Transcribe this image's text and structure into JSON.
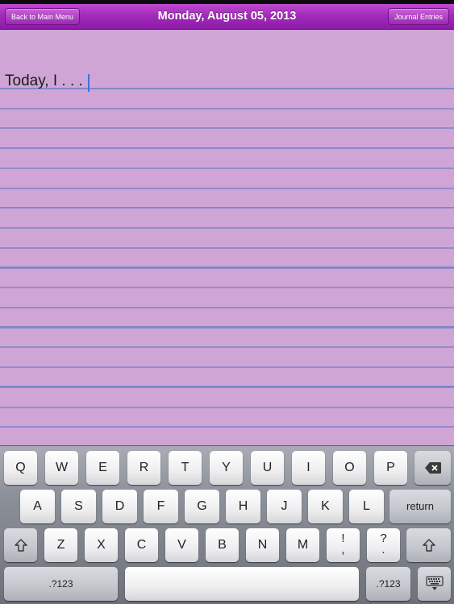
{
  "nav": {
    "back_label": "Back to Main Menu",
    "title": "Monday, August 05, 2013",
    "journal_label": "Journal Entries"
  },
  "editor": {
    "text": "Today, I . . ."
  },
  "keyboard": {
    "row1": [
      "Q",
      "W",
      "E",
      "R",
      "T",
      "Y",
      "U",
      "I",
      "O",
      "P"
    ],
    "row2": [
      "A",
      "S",
      "D",
      "F",
      "G",
      "H",
      "J",
      "K",
      "L"
    ],
    "row3": [
      "Z",
      "X",
      "C",
      "V",
      "B",
      "N",
      "M"
    ],
    "return_label": "return",
    "exclaim_top": "!",
    "exclaim_bottom": ",",
    "question_top": "?",
    "question_bottom": ".",
    "numbers_label": ".?123",
    "icons": {
      "delete": "backspace-icon",
      "shift": "shift-arrow-icon",
      "hide": "keyboard-hide-icon"
    }
  },
  "colors": {
    "nav_purple": "#a22cba",
    "paper": "#cfa5d6",
    "rule_line": "#7d84c8",
    "cursor": "#3f6fe0"
  }
}
